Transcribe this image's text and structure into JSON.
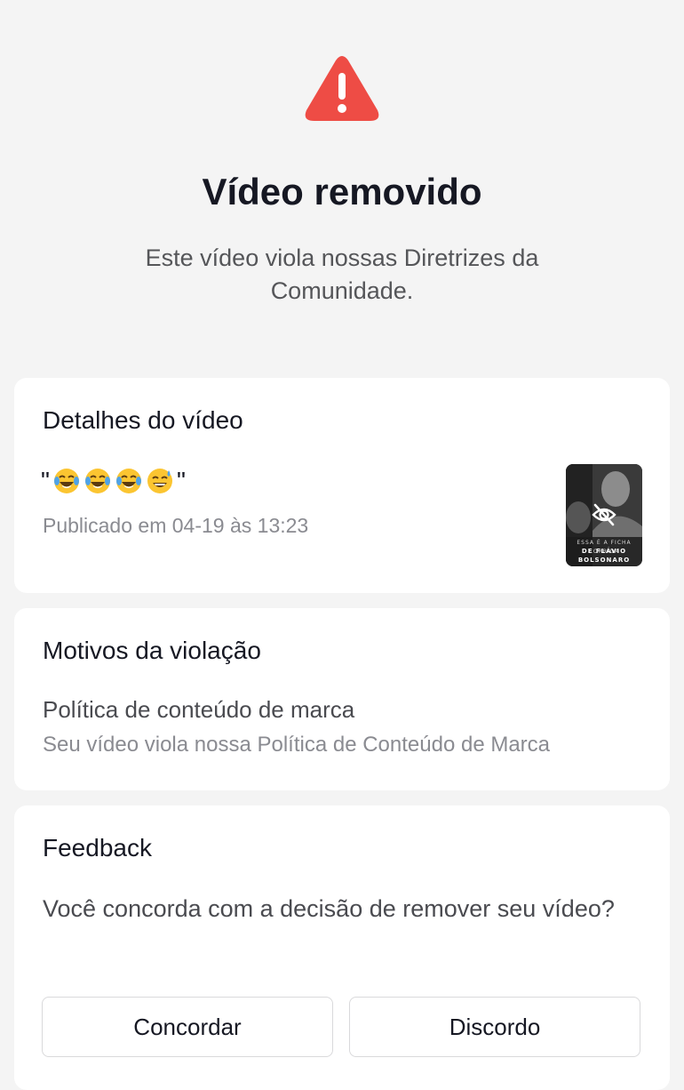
{
  "header": {
    "title": "Vídeo removido",
    "subtitle": "Este vídeo viola nossas Diretrizes da Comunidade."
  },
  "details": {
    "title": "Detalhes do vídeo",
    "caption_open": "\"",
    "caption_close": "\"",
    "caption_emojis": [
      "face-with-tears-of-joy",
      "face-with-tears-of-joy",
      "face-with-tears-of-joy",
      "grinning-face-with-sweat"
    ],
    "published": "Publicado em 04-19 às 13:23",
    "thumbnail": {
      "overlay_icon": "eye-slash-icon",
      "text_top": "ESSA É A FICHA CORRIDA",
      "text_bottom": "DE FLÁVIO BOLSONARO"
    }
  },
  "reasons": {
    "title": "Motivos da violação",
    "policy_name": "Política de conteúdo de marca",
    "policy_description": "Seu vídeo viola nossa Política de Conteúdo de Marca"
  },
  "feedback": {
    "title": "Feedback",
    "question": "Você concorda com a decisão de remover seu vídeo?",
    "agree_label": "Concordar",
    "disagree_label": "Discordo"
  },
  "colors": {
    "background": "#f4f4f4",
    "card": "#ffffff",
    "warning": "#ee4c45",
    "text_primary": "#161823",
    "text_secondary": "#8a8b91"
  }
}
